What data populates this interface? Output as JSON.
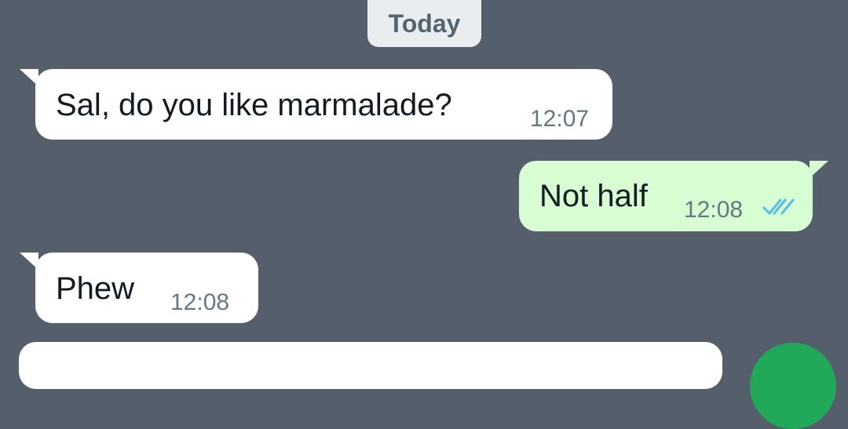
{
  "chat": {
    "date_divider": "Today",
    "messages": [
      {
        "direction": "incoming",
        "text": "Sal, do you like marmalade?",
        "time": "12:07"
      },
      {
        "direction": "outgoing",
        "text": "Not half",
        "time": "12:08",
        "status": "read"
      },
      {
        "direction": "incoming",
        "text": "Phew",
        "time": "12:08"
      }
    ]
  },
  "icons": {
    "read_receipt": "double-check-icon",
    "action_button": "round-action-button"
  },
  "colors": {
    "background": "#555f6b",
    "incoming_bubble": "#ffffff",
    "outgoing_bubble": "#d9fdd3",
    "read_ticks": "#53bdeb",
    "action_button": "#21a858",
    "date_chip": "#e9edef"
  }
}
